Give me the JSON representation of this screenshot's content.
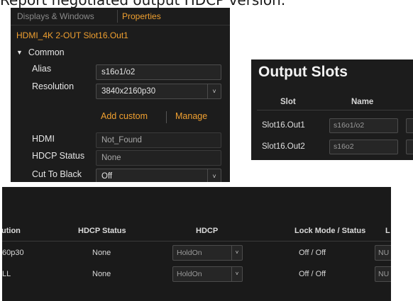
{
  "caption": "Report negotiated output HDCP version.",
  "properties_panel": {
    "tabs": [
      {
        "label": "Displays & Windows"
      },
      {
        "label": "Properties"
      }
    ],
    "device_title": "HDMI_4K 2-OUT Slot16.Out1",
    "section": "Common",
    "fields": {
      "alias": {
        "label": "Alias",
        "value": "s16o1/o2"
      },
      "resolution": {
        "label": "Resolution",
        "value": "3840x2160p30"
      },
      "hdmi": {
        "label": "HDMI",
        "value": "Not_Found"
      },
      "hdcp_status": {
        "label": "HDCP Status",
        "value": "None"
      },
      "cut_to_black": {
        "label": "Cut To Black",
        "value": "Off"
      }
    },
    "links": {
      "add_custom": "Add custom",
      "manage": "Manage"
    }
  },
  "output_slots": {
    "title": "Output Slots",
    "headers": {
      "slot": "Slot",
      "name": "Name"
    },
    "rows": [
      {
        "slot": "Slot16.Out1",
        "name": "s16o1/o2"
      },
      {
        "slot": "Slot16.Out2",
        "name": "s16o2"
      }
    ]
  },
  "table_strip": {
    "headers": {
      "resolution": "ution",
      "hdcp_status": "HDCP Status",
      "hdcp": "HDCP",
      "lock_mode": "Lock Mode / Status",
      "edge": "L"
    },
    "rows": [
      {
        "resolution": "60p30",
        "hdcp_status": "None",
        "hdcp": "HoldOn",
        "lock_mode": "Off / Off",
        "edge": "NU"
      },
      {
        "resolution": "LL",
        "hdcp_status": "None",
        "hdcp": "HoldOn",
        "lock_mode": "Off / Off",
        "edge": "NU"
      }
    ]
  }
}
